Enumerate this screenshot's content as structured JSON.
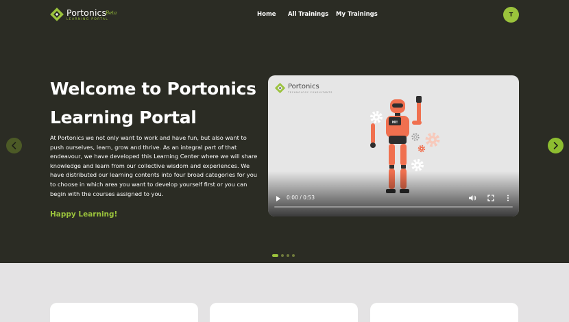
{
  "nav": {
    "logo": {
      "name": "Portonics",
      "subtitle": "LEARNING PORTAL",
      "badge": "Beta"
    },
    "links": [
      {
        "label": "Home"
      },
      {
        "label": "All Trainings"
      },
      {
        "label": "My Trainings"
      }
    ],
    "avatar_initial": "T"
  },
  "hero": {
    "title": "Welcome to Portonics Learning Portal",
    "description": "At Portonics we not only want to work and have fun, but also want to push ourselves, learn, grow and thrive. As an integral part of that endeavour, we have developed this Learning Center where we will share knowledge and learn from our collective wisdom and experiences. We have distributed our learning contents into four broad categories for you to choose in which area you want to develop yourself first or you can begin with the courses assigned to you.",
    "cta": "Happy Learning!"
  },
  "video": {
    "logo": {
      "name": "Portonics",
      "subtitle": "TECHNOLOGY CONSULTANTS"
    },
    "robot_badge": "HI!",
    "time": "0:00 / 0:53",
    "progress": 0
  },
  "carousel": {
    "slide_count": 4,
    "active_index": 0
  },
  "colors": {
    "accent": "#9bc33c",
    "dark": "#2b2c24",
    "robot": "#f0704f"
  },
  "icons": [
    "play-icon",
    "volume-icon",
    "fullscreen-icon",
    "more-vertical-icon",
    "chevron-left-icon",
    "chevron-right-icon"
  ]
}
